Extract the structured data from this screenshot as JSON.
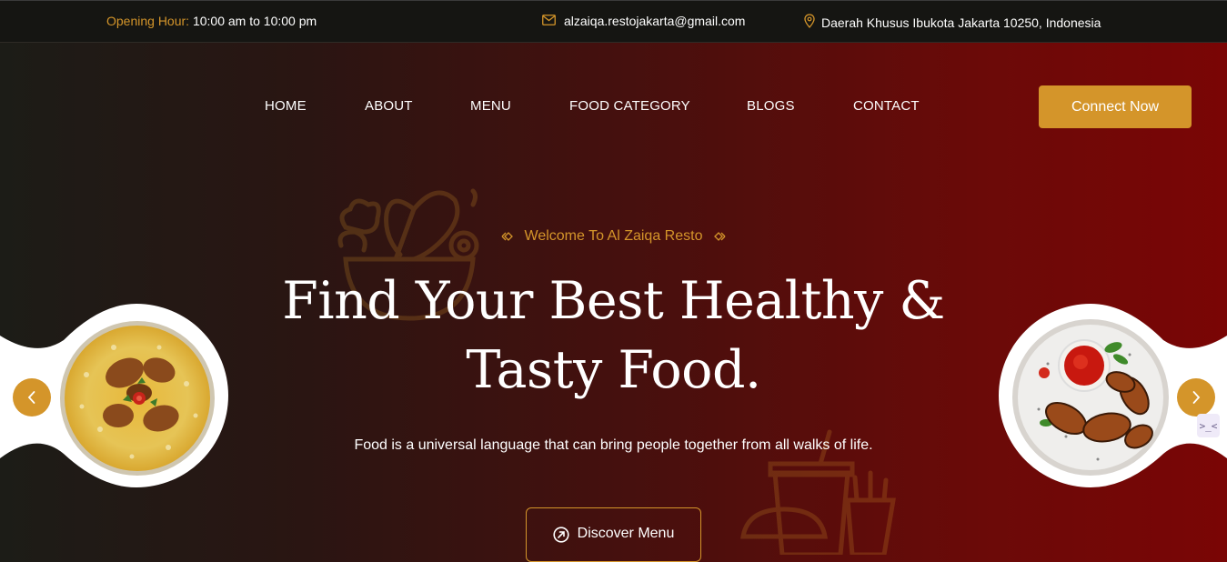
{
  "topbar": {
    "hours_label": "Opening Hour:",
    "hours_value": "10:00 am to 10:00 pm",
    "email": "alzaiqa.restojakarta@gmail.com",
    "address": "Daerah Khusus Ibukota Jakarta 10250, Indonesia"
  },
  "nav": {
    "items": [
      "HOME",
      "ABOUT",
      "MENU",
      "FOOD CATEGORY",
      "BLOGS",
      "CONTACT"
    ],
    "cta": "Connect Now"
  },
  "hero": {
    "welcome": "Welcome To Al Zaiqa Resto",
    "headline_line1": "Find Your Best Healthy &",
    "headline_line2": "Tasty Food.",
    "subtitle": "Food is a universal language that can bring people together from all walks of life.",
    "button": "Discover Menu"
  },
  "slider": {
    "prev_icon": "chevron-left-icon",
    "next_icon": "chevron-right-icon"
  },
  "widget": {
    "label": ">_<"
  },
  "colors": {
    "accent": "#d4952a",
    "topbar_bg": "#151512",
    "gradient_start": "#1c1c17",
    "gradient_end": "#7a0505"
  }
}
